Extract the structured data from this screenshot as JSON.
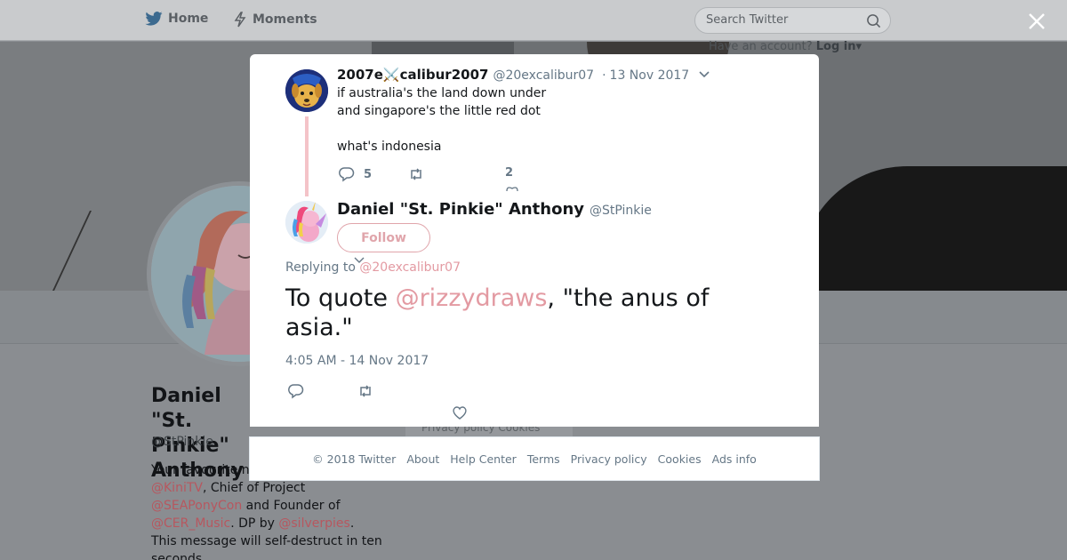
{
  "topbar": {
    "home_label": "Home",
    "moments_label": "Moments",
    "search_placeholder": "Search Twitter",
    "have_account_text": "Have an account?",
    "login_label": "Log in"
  },
  "profile": {
    "name": "Daniel \"St. Pinkie\" Anthony",
    "handle": "@StPinkie",
    "bio_prefix": "Your favourite n",
    "bio_mention_1": "@KiniTV",
    "bio_text_1": ", Chief of Project",
    "bio_mention_2": "@SEAPonyCon",
    "bio_text_2": " and Founder of",
    "bio_mention_3": "@CER_Music",
    "bio_text_3": ". DP by",
    "bio_mention_4": "@silverpies",
    "bio_text_4": ".",
    "bio_text_5": "This message will self-destruct in ten seconds.",
    "footer_ghost": "Privacy policy  Cookies"
  },
  "parent_tweet": {
    "display_name": "2007e⚔️calibur2007",
    "handle": "@20excalibur07",
    "separator": "·",
    "date": "13 Nov 2017",
    "text": "if australia's the land down under\nand singapore's the little red dot\n\nwhat's indonesia",
    "reply_count": "5",
    "retweet_count": "",
    "like_count": "2",
    "avatar_icon": "dog-character-avatar"
  },
  "main_tweet": {
    "display_name": "Daniel \"St. Pinkie\" Anthony",
    "handle": "@StPinkie",
    "follow_label": "Follow",
    "replying_prefix": "Replying to",
    "replying_to": "@20excalibur07",
    "text_before": "To quote ",
    "text_mention": "@rizzydraws",
    "text_after": ", \"the anus of asia.\"",
    "timestamp": "4:05 AM - 14 Nov 2017",
    "avatar_icon": "pony-avatar"
  },
  "footer": {
    "copyright": "© 2018 Twitter",
    "links": [
      "About",
      "Help Center",
      "Terms",
      "Privacy policy",
      "Cookies",
      "Ads info"
    ]
  },
  "colors": {
    "accent": "#e39aa2",
    "follow_border": "#e0a5ab",
    "thread_line": "#f4c3c8",
    "muted_text": "#657786"
  }
}
